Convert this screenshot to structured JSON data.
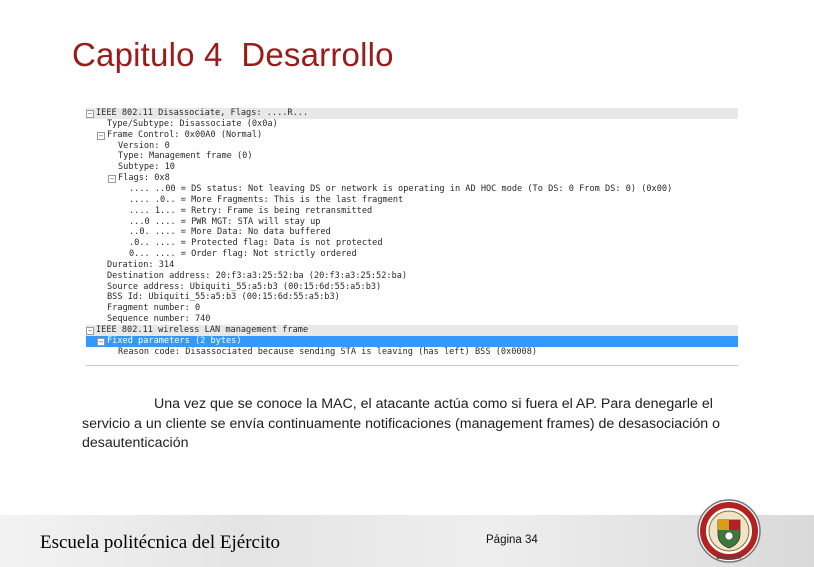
{
  "slide": {
    "title": "Capitulo 4  Desarrollo"
  },
  "packet_tree": {
    "rows": [
      {
        "text": "IEEE 802.11 Disassociate, Flags: ....R...",
        "toggle": "minus",
        "level": 0,
        "style": "header"
      },
      {
        "text": "Type/Subtype: Disassociate (0x0a)",
        "toggle": "",
        "level": 1,
        "style": ""
      },
      {
        "text": "Frame Control: 0x00A0 (Normal)",
        "toggle": "minus",
        "level": 1,
        "style": ""
      },
      {
        "text": "Version: 0",
        "toggle": "",
        "level": 2,
        "style": ""
      },
      {
        "text": "Type: Management frame (0)",
        "toggle": "",
        "level": 2,
        "style": ""
      },
      {
        "text": "Subtype: 10",
        "toggle": "",
        "level": 2,
        "style": ""
      },
      {
        "text": "Flags: 0x8",
        "toggle": "minus",
        "level": 2,
        "style": ""
      },
      {
        "text": ".... ..00 = DS status: Not leaving DS or network is operating in AD HOC mode (To DS: 0 From DS: 0) (0x00)",
        "toggle": "",
        "level": 3,
        "style": ""
      },
      {
        "text": ".... .0.. = More Fragments: This is the last fragment",
        "toggle": "",
        "level": 3,
        "style": ""
      },
      {
        "text": ".... 1... = Retry: Frame is being retransmitted",
        "toggle": "",
        "level": 3,
        "style": ""
      },
      {
        "text": "...0 .... = PWR MGT: STA will stay up",
        "toggle": "",
        "level": 3,
        "style": ""
      },
      {
        "text": "..0. .... = More Data: No data buffered",
        "toggle": "",
        "level": 3,
        "style": ""
      },
      {
        "text": ".0.. .... = Protected flag: Data is not protected",
        "toggle": "",
        "level": 3,
        "style": ""
      },
      {
        "text": "0... .... = Order flag: Not strictly ordered",
        "toggle": "",
        "level": 3,
        "style": ""
      },
      {
        "text": "Duration: 314",
        "toggle": "",
        "level": 1,
        "style": ""
      },
      {
        "text": "Destination address: 20:f3:a3:25:52:ba (20:f3:a3:25:52:ba)",
        "toggle": "",
        "level": 1,
        "style": ""
      },
      {
        "text": "Source address: Ubiquiti_55:a5:b3 (00:15:6d:55:a5:b3)",
        "toggle": "",
        "level": 1,
        "style": ""
      },
      {
        "text": "BSS Id: Ubiquiti_55:a5:b3 (00:15:6d:55:a5:b3)",
        "toggle": "",
        "level": 1,
        "style": ""
      },
      {
        "text": "Fragment number: 0",
        "toggle": "",
        "level": 1,
        "style": ""
      },
      {
        "text": "Sequence number: 740",
        "toggle": "",
        "level": 1,
        "style": ""
      },
      {
        "text": "IEEE 802.11 wireless LAN management frame",
        "toggle": "minus",
        "level": 0,
        "style": "header"
      },
      {
        "text": "Fixed parameters (2 bytes)",
        "toggle": "minus",
        "level": 1,
        "style": "selected"
      },
      {
        "text": "Reason code: Disassociated because sending STA is leaving (has left) BSS (0x0008)",
        "toggle": "",
        "level": 2,
        "style": ""
      }
    ]
  },
  "body": {
    "paragraph": "Una vez que se conoce la MAC, el atacante actúa como si fuera el  AP. Para denegarle el servicio a un cliente se envía continuamente notificaciones (management frames) de desasociación o desautenticación"
  },
  "footer": {
    "school_name": "Escuela politécnica del Ejército",
    "page_label": "Página 34",
    "seal_icon": "university-seal-icon",
    "seal_caption": "ECUADOR",
    "colors": {
      "title": "#9b1b1b",
      "selected_row": "#3399ff",
      "seal_red": "#b22222",
      "seal_gold": "#d4a017",
      "seal_green": "#3c7a3c"
    }
  }
}
